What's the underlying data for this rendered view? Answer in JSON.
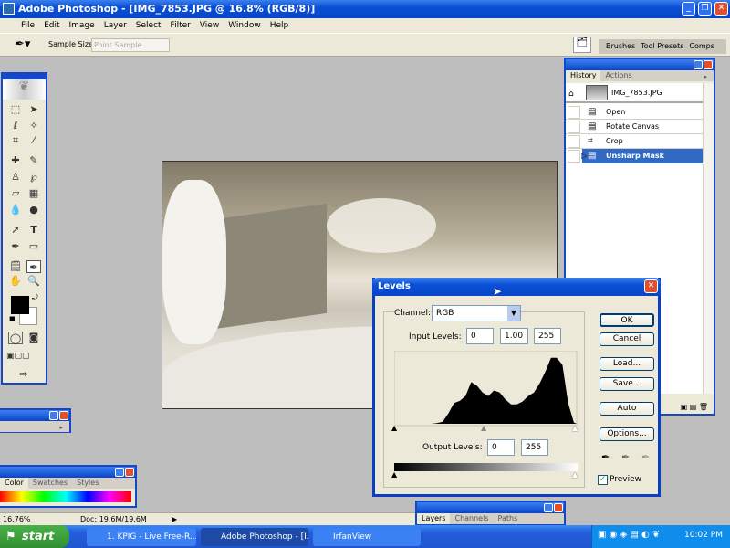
{
  "window": {
    "title": "Adobe Photoshop - [IMG_7853.JPG @ 16.8% (RGB/8)]"
  },
  "menu": [
    "File",
    "Edit",
    "Image",
    "Layer",
    "Select",
    "Filter",
    "View",
    "Window",
    "Help"
  ],
  "options": {
    "sample_size_label": "Sample Size:",
    "sample_size_value": "Point Sample"
  },
  "palette_well": {
    "tabs": [
      "Brushes",
      "Tool Presets",
      "Comps"
    ]
  },
  "history": {
    "tabs": [
      "History",
      "Actions"
    ],
    "snapshot": "IMG_7853.JPG",
    "steps": [
      "Open",
      "Rotate Canvas",
      "Crop",
      "Unsharp Mask"
    ],
    "active_step": "Unsharp Mask"
  },
  "levels": {
    "title": "Levels",
    "channel_label": "Channel:",
    "channel_value": "RGB",
    "input_label": "Input Levels:",
    "input": [
      "0",
      "1.00",
      "255"
    ],
    "output_label": "Output Levels:",
    "output": [
      "0",
      "255"
    ],
    "buttons": {
      "ok": "OK",
      "cancel": "Cancel",
      "load": "Load...",
      "save": "Save...",
      "auto": "Auto",
      "options": "Options..."
    },
    "preview_label": "Preview",
    "preview_checked": true,
    "histogram_profile": [
      0,
      0,
      0,
      0,
      0,
      0,
      0,
      0.01,
      0.03,
      0.15,
      0.3,
      0.33,
      0.4,
      0.6,
      0.55,
      0.45,
      0.4,
      0.48,
      0.45,
      0.35,
      0.28,
      0.28,
      0.32,
      0.4,
      0.45,
      0.58,
      0.75,
      0.95,
      0.95,
      0.85,
      0.3,
      0.02
    ]
  },
  "color_panel": {
    "tabs": [
      "Color",
      "Swatches",
      "Styles"
    ]
  },
  "layers_panel": {
    "tabs": [
      "Layers",
      "Channels",
      "Paths"
    ]
  },
  "status": {
    "zoom": "16.76%",
    "doc": "Doc: 19.6M/19.6M"
  },
  "taskbar": {
    "start": "start",
    "tasks": [
      "1. KPIG - Live Free-R...",
      "Adobe Photoshop - [I...",
      "IrfanView"
    ],
    "clock": "10:02 PM"
  }
}
